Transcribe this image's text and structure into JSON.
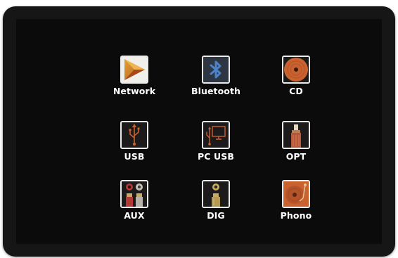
{
  "sources": [
    {
      "id": "network",
      "label": "Network",
      "icon": "network-play-icon"
    },
    {
      "id": "bluetooth",
      "label": "Bluetooth",
      "icon": "bluetooth-icon"
    },
    {
      "id": "cd",
      "label": "CD",
      "icon": "cd-disc-icon"
    },
    {
      "id": "usb",
      "label": "USB",
      "icon": "usb-icon"
    },
    {
      "id": "pc-usb",
      "label": "PC USB",
      "icon": "pc-usb-icon"
    },
    {
      "id": "opt",
      "label": "OPT",
      "icon": "optical-connector-icon"
    },
    {
      "id": "aux",
      "label": "AUX",
      "icon": "rca-connectors-icon"
    },
    {
      "id": "dig",
      "label": "DIG",
      "icon": "coaxial-connector-icon"
    },
    {
      "id": "phono",
      "label": "Phono",
      "icon": "turntable-icon"
    }
  ],
  "colors": {
    "bezel": "#161616",
    "screen": "#0b0b0b",
    "tile_border": "#ececec",
    "label": "#ffffff",
    "accent_orange": "#c9622f",
    "accent_blue": "#3f74b8",
    "accent_gold": "#c8ab62"
  }
}
